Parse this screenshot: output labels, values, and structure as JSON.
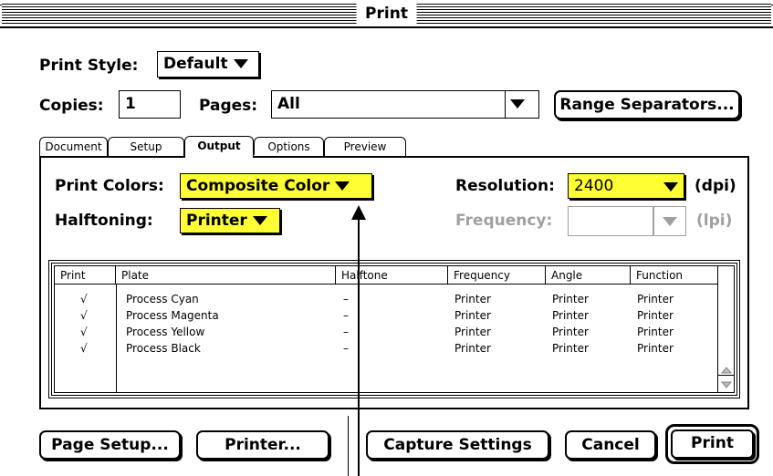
{
  "window": {
    "title": "Print"
  },
  "print_style": {
    "label": "Print Style:",
    "value": "Default"
  },
  "copies": {
    "label": "Copies:",
    "value": "1"
  },
  "pages": {
    "label": "Pages:",
    "value": "All"
  },
  "range_separators_label": "Range Separators...",
  "tabs": [
    {
      "label": "Document",
      "active": false
    },
    {
      "label": "Setup",
      "active": false
    },
    {
      "label": "Output",
      "active": true
    },
    {
      "label": "Options",
      "active": false
    },
    {
      "label": "Preview",
      "active": false
    }
  ],
  "output": {
    "print_colors_label": "Print Colors:",
    "print_colors_value": "Composite Color",
    "halftoning_label": "Halftoning:",
    "halftoning_value": "Printer",
    "resolution_label": "Resolution:",
    "resolution_value": "2400",
    "resolution_unit": "(dpi)",
    "frequency_label": "Frequency:",
    "frequency_value": "",
    "frequency_unit": "(lpi)"
  },
  "plates_table": {
    "headers": [
      "Print",
      "Plate",
      "Halftone",
      "Frequency",
      "Angle",
      "Function"
    ],
    "rows": [
      {
        "print": "√",
        "plate": "Process Cyan",
        "halftone": "–",
        "frequency": "Printer",
        "angle": "Printer",
        "function": "Printer"
      },
      {
        "print": "√",
        "plate": "Process Magenta",
        "halftone": "–",
        "frequency": "Printer",
        "angle": "Printer",
        "function": "Printer"
      },
      {
        "print": "√",
        "plate": "Process Yellow",
        "halftone": "–",
        "frequency": "Printer",
        "angle": "Printer",
        "function": "Printer"
      },
      {
        "print": "√",
        "plate": "Process Black",
        "halftone": "–",
        "frequency": "Printer",
        "angle": "Printer",
        "function": "Printer"
      }
    ]
  },
  "buttons": {
    "page_setup": "Page Setup...",
    "printer": "Printer...",
    "capture_settings": "Capture Settings",
    "cancel": "Cancel",
    "print": "Print"
  },
  "colors": {
    "highlight": "#ffff33",
    "disabled": "#a0a0a0"
  }
}
